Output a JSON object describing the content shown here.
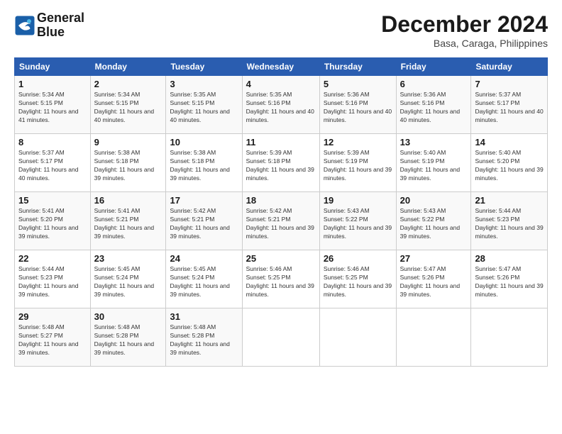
{
  "logo": {
    "line1": "General",
    "line2": "Blue"
  },
  "title": "December 2024",
  "location": "Basa, Caraga, Philippines",
  "days_header": [
    "Sunday",
    "Monday",
    "Tuesday",
    "Wednesday",
    "Thursday",
    "Friday",
    "Saturday"
  ],
  "weeks": [
    [
      {
        "day": "1",
        "sunrise": "Sunrise: 5:34 AM",
        "sunset": "Sunset: 5:15 PM",
        "daylight": "Daylight: 11 hours and 41 minutes."
      },
      {
        "day": "2",
        "sunrise": "Sunrise: 5:34 AM",
        "sunset": "Sunset: 5:15 PM",
        "daylight": "Daylight: 11 hours and 40 minutes."
      },
      {
        "day": "3",
        "sunrise": "Sunrise: 5:35 AM",
        "sunset": "Sunset: 5:15 PM",
        "daylight": "Daylight: 11 hours and 40 minutes."
      },
      {
        "day": "4",
        "sunrise": "Sunrise: 5:35 AM",
        "sunset": "Sunset: 5:16 PM",
        "daylight": "Daylight: 11 hours and 40 minutes."
      },
      {
        "day": "5",
        "sunrise": "Sunrise: 5:36 AM",
        "sunset": "Sunset: 5:16 PM",
        "daylight": "Daylight: 11 hours and 40 minutes."
      },
      {
        "day": "6",
        "sunrise": "Sunrise: 5:36 AM",
        "sunset": "Sunset: 5:16 PM",
        "daylight": "Daylight: 11 hours and 40 minutes."
      },
      {
        "day": "7",
        "sunrise": "Sunrise: 5:37 AM",
        "sunset": "Sunset: 5:17 PM",
        "daylight": "Daylight: 11 hours and 40 minutes."
      }
    ],
    [
      {
        "day": "8",
        "sunrise": "Sunrise: 5:37 AM",
        "sunset": "Sunset: 5:17 PM",
        "daylight": "Daylight: 11 hours and 40 minutes."
      },
      {
        "day": "9",
        "sunrise": "Sunrise: 5:38 AM",
        "sunset": "Sunset: 5:18 PM",
        "daylight": "Daylight: 11 hours and 39 minutes."
      },
      {
        "day": "10",
        "sunrise": "Sunrise: 5:38 AM",
        "sunset": "Sunset: 5:18 PM",
        "daylight": "Daylight: 11 hours and 39 minutes."
      },
      {
        "day": "11",
        "sunrise": "Sunrise: 5:39 AM",
        "sunset": "Sunset: 5:18 PM",
        "daylight": "Daylight: 11 hours and 39 minutes."
      },
      {
        "day": "12",
        "sunrise": "Sunrise: 5:39 AM",
        "sunset": "Sunset: 5:19 PM",
        "daylight": "Daylight: 11 hours and 39 minutes."
      },
      {
        "day": "13",
        "sunrise": "Sunrise: 5:40 AM",
        "sunset": "Sunset: 5:19 PM",
        "daylight": "Daylight: 11 hours and 39 minutes."
      },
      {
        "day": "14",
        "sunrise": "Sunrise: 5:40 AM",
        "sunset": "Sunset: 5:20 PM",
        "daylight": "Daylight: 11 hours and 39 minutes."
      }
    ],
    [
      {
        "day": "15",
        "sunrise": "Sunrise: 5:41 AM",
        "sunset": "Sunset: 5:20 PM",
        "daylight": "Daylight: 11 hours and 39 minutes."
      },
      {
        "day": "16",
        "sunrise": "Sunrise: 5:41 AM",
        "sunset": "Sunset: 5:21 PM",
        "daylight": "Daylight: 11 hours and 39 minutes."
      },
      {
        "day": "17",
        "sunrise": "Sunrise: 5:42 AM",
        "sunset": "Sunset: 5:21 PM",
        "daylight": "Daylight: 11 hours and 39 minutes."
      },
      {
        "day": "18",
        "sunrise": "Sunrise: 5:42 AM",
        "sunset": "Sunset: 5:21 PM",
        "daylight": "Daylight: 11 hours and 39 minutes."
      },
      {
        "day": "19",
        "sunrise": "Sunrise: 5:43 AM",
        "sunset": "Sunset: 5:22 PM",
        "daylight": "Daylight: 11 hours and 39 minutes."
      },
      {
        "day": "20",
        "sunrise": "Sunrise: 5:43 AM",
        "sunset": "Sunset: 5:22 PM",
        "daylight": "Daylight: 11 hours and 39 minutes."
      },
      {
        "day": "21",
        "sunrise": "Sunrise: 5:44 AM",
        "sunset": "Sunset: 5:23 PM",
        "daylight": "Daylight: 11 hours and 39 minutes."
      }
    ],
    [
      {
        "day": "22",
        "sunrise": "Sunrise: 5:44 AM",
        "sunset": "Sunset: 5:23 PM",
        "daylight": "Daylight: 11 hours and 39 minutes."
      },
      {
        "day": "23",
        "sunrise": "Sunrise: 5:45 AM",
        "sunset": "Sunset: 5:24 PM",
        "daylight": "Daylight: 11 hours and 39 minutes."
      },
      {
        "day": "24",
        "sunrise": "Sunrise: 5:45 AM",
        "sunset": "Sunset: 5:24 PM",
        "daylight": "Daylight: 11 hours and 39 minutes."
      },
      {
        "day": "25",
        "sunrise": "Sunrise: 5:46 AM",
        "sunset": "Sunset: 5:25 PM",
        "daylight": "Daylight: 11 hours and 39 minutes."
      },
      {
        "day": "26",
        "sunrise": "Sunrise: 5:46 AM",
        "sunset": "Sunset: 5:25 PM",
        "daylight": "Daylight: 11 hours and 39 minutes."
      },
      {
        "day": "27",
        "sunrise": "Sunrise: 5:47 AM",
        "sunset": "Sunset: 5:26 PM",
        "daylight": "Daylight: 11 hours and 39 minutes."
      },
      {
        "day": "28",
        "sunrise": "Sunrise: 5:47 AM",
        "sunset": "Sunset: 5:26 PM",
        "daylight": "Daylight: 11 hours and 39 minutes."
      }
    ],
    [
      {
        "day": "29",
        "sunrise": "Sunrise: 5:48 AM",
        "sunset": "Sunset: 5:27 PM",
        "daylight": "Daylight: 11 hours and 39 minutes."
      },
      {
        "day": "30",
        "sunrise": "Sunrise: 5:48 AM",
        "sunset": "Sunset: 5:28 PM",
        "daylight": "Daylight: 11 hours and 39 minutes."
      },
      {
        "day": "31",
        "sunrise": "Sunrise: 5:48 AM",
        "sunset": "Sunset: 5:28 PM",
        "daylight": "Daylight: 11 hours and 39 minutes."
      },
      null,
      null,
      null,
      null
    ]
  ]
}
